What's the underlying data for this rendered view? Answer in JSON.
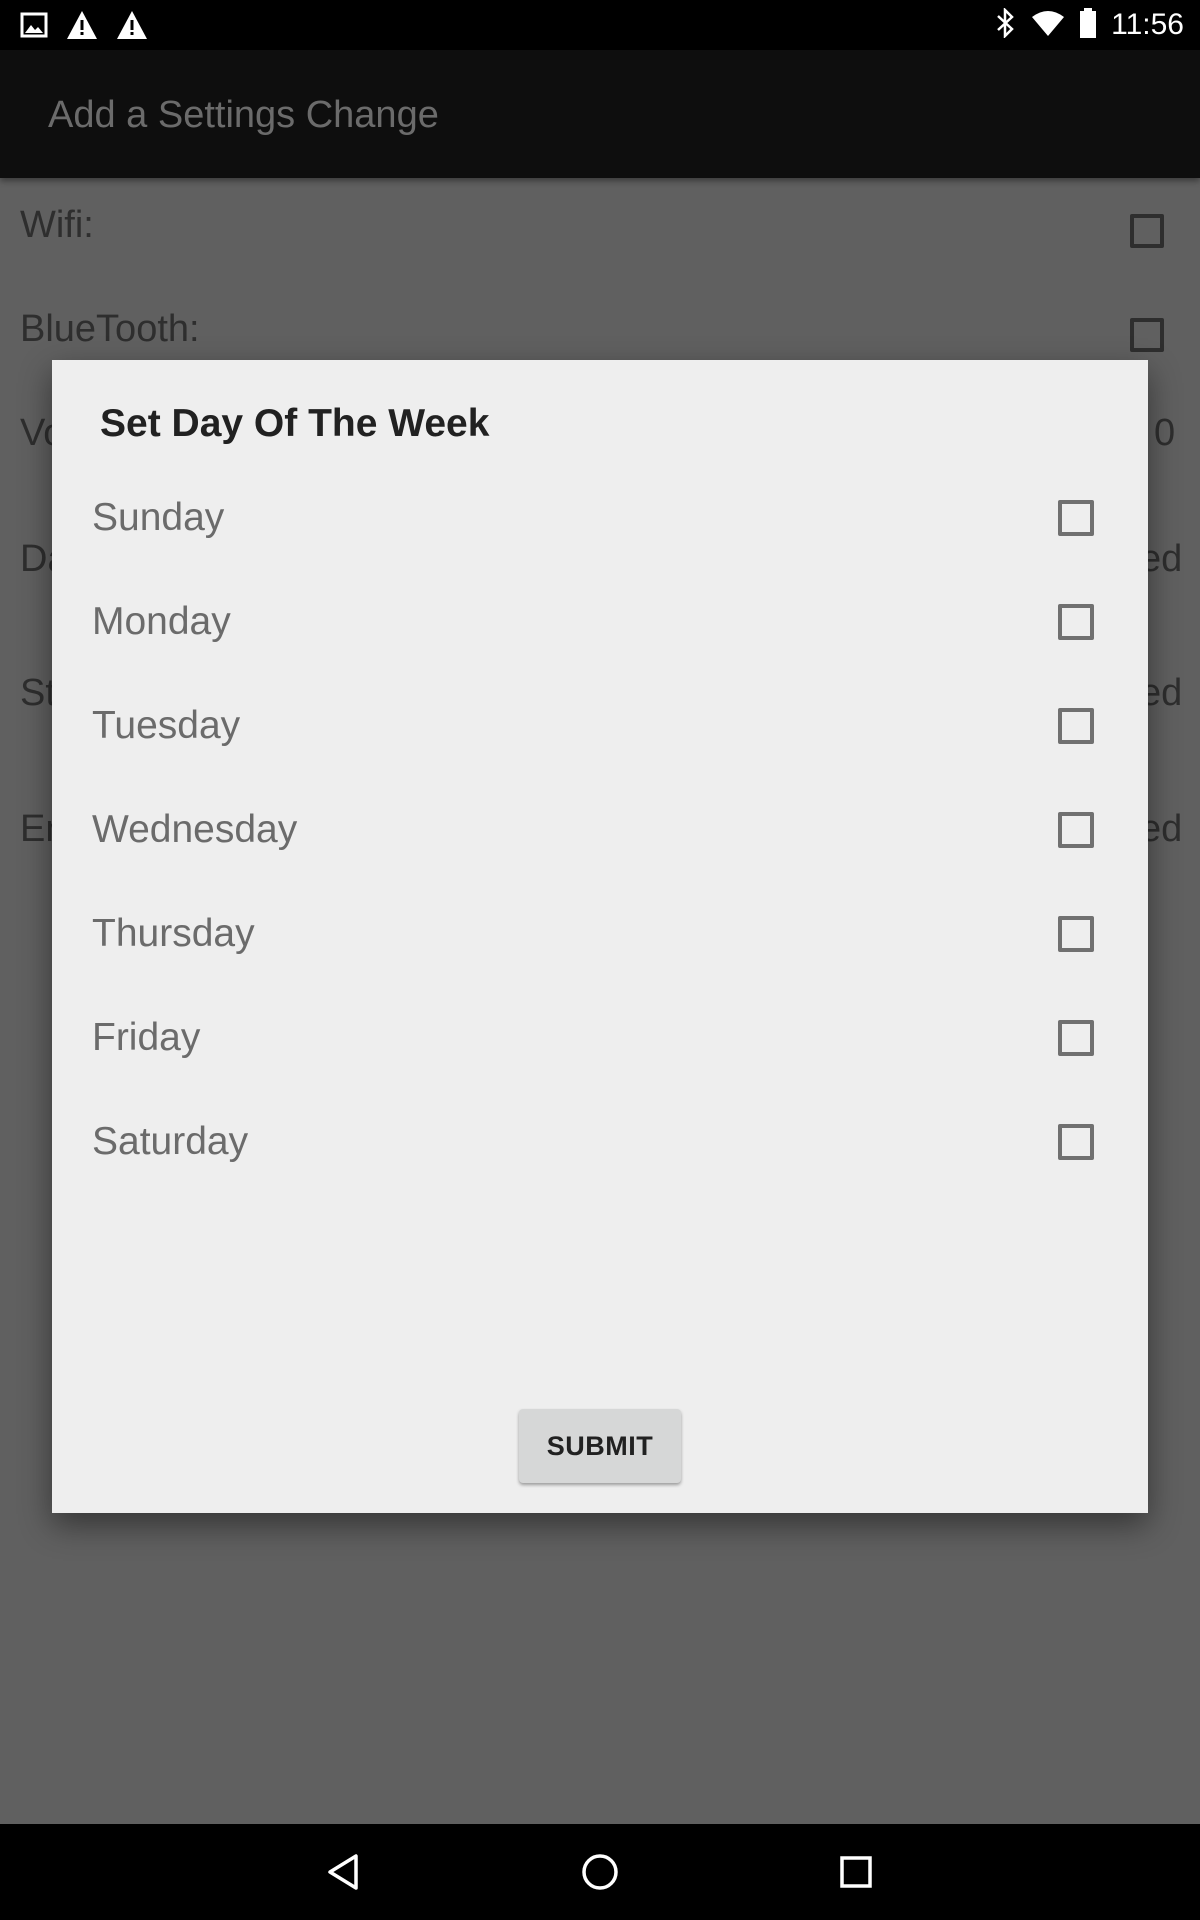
{
  "status_bar": {
    "time": "11:56",
    "icons_left": [
      "image-icon",
      "warning-icon",
      "warning-icon"
    ],
    "icons_right": [
      "bluetooth-icon",
      "wifi-icon",
      "battery-icon"
    ]
  },
  "toolbar": {
    "title": "Add a Settings Change"
  },
  "background": {
    "rows": [
      {
        "label": "Wifi:"
      },
      {
        "label": "BlueTooth:"
      },
      {
        "label": "Vo",
        "right_text": "0"
      },
      {
        "label": "Da",
        "right_text": "ed"
      },
      {
        "label": "St",
        "right_text": "ed"
      },
      {
        "label": "En",
        "right_text": "ed"
      }
    ]
  },
  "dialog": {
    "title": "Set Day Of The Week",
    "days": [
      {
        "label": "Sunday",
        "checked": false
      },
      {
        "label": "Monday",
        "checked": false
      },
      {
        "label": "Tuesday",
        "checked": false
      },
      {
        "label": "Wednesday",
        "checked": false
      },
      {
        "label": "Thursday",
        "checked": false
      },
      {
        "label": "Friday",
        "checked": false
      },
      {
        "label": "Saturday",
        "checked": false
      }
    ],
    "submit_label": "SUBMIT"
  },
  "nav_bar": {
    "buttons": [
      "back-icon",
      "home-icon",
      "recents-icon"
    ]
  },
  "colors": {
    "dim_background": "#606060",
    "dialog_background": "#eeeeee",
    "toolbar": "#0e0e0e"
  }
}
